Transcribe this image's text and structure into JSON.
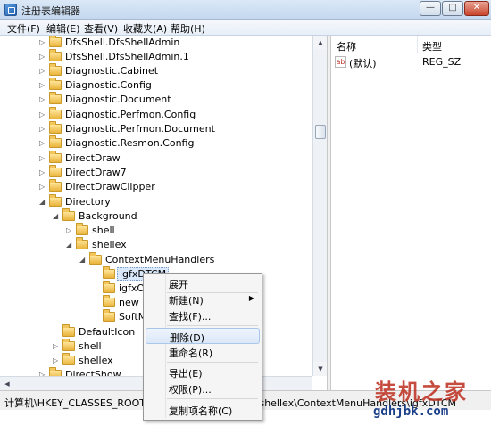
{
  "window": {
    "title": "注册表编辑器",
    "min_glyph": "—",
    "max_glyph": "□",
    "close_glyph": "✕"
  },
  "menu": [
    "文件(F)",
    "编辑(E)",
    "查看(V)",
    "收藏夹(A)",
    "帮助(H)"
  ],
  "tree": [
    {
      "label": "DfsShell.DfsShellAdmin",
      "expander": "▷"
    },
    {
      "label": "DfsShell.DfsShellAdmin.1",
      "expander": "▷"
    },
    {
      "label": "Diagnostic.Cabinet",
      "expander": "▷"
    },
    {
      "label": "Diagnostic.Config",
      "expander": "▷"
    },
    {
      "label": "Diagnostic.Document",
      "expander": "▷"
    },
    {
      "label": "Diagnostic.Perfmon.Config",
      "expander": "▷"
    },
    {
      "label": "Diagnostic.Perfmon.Document",
      "expander": "▷"
    },
    {
      "label": "Diagnostic.Resmon.Config",
      "expander": "▷"
    },
    {
      "label": "DirectDraw",
      "expander": "▷"
    },
    {
      "label": "DirectDraw7",
      "expander": "▷"
    },
    {
      "label": "DirectDrawClipper",
      "expander": "▷"
    },
    {
      "label": "Directory",
      "expander": "◢"
    },
    {
      "label": "Background",
      "expander": "◢"
    },
    {
      "label": "shell",
      "expander": "▷"
    },
    {
      "label": "shellex",
      "expander": "◢"
    },
    {
      "label": "ContextMenuHandlers",
      "expander": "◢"
    },
    {
      "label": "igfxDTCM",
      "expander": ""
    },
    {
      "label": "igfxOSP",
      "expander": ""
    },
    {
      "label": "new",
      "expander": ""
    },
    {
      "label": "SoftMgr",
      "expander": ""
    },
    {
      "label": "DefaultIcon",
      "expander": ""
    },
    {
      "label": "shell",
      "expander": "▷"
    },
    {
      "label": "shellex",
      "expander": "▷"
    },
    {
      "label": "DirectShow",
      "expander": "▷"
    }
  ],
  "list": {
    "col_name": "名称",
    "col_type": "类型",
    "rows": [
      {
        "icon": "ab",
        "name": "(默认)",
        "type": "REG_SZ"
      }
    ]
  },
  "status": {
    "path": "计算机\\HKEY_CLASSES_ROOT\\Directory\\Background\\shellex\\ContextMenuHandlers\\igfxDTCM"
  },
  "context_menu": {
    "items": [
      {
        "label": "展开"
      },
      {
        "label": "新建(N)",
        "submenu": "▶"
      },
      {
        "label": "查找(F)..."
      },
      {
        "label": "删除(D)"
      },
      {
        "label": "重命名(R)"
      },
      {
        "label": "导出(E)"
      },
      {
        "label": "权限(P)..."
      },
      {
        "label": "复制项名称(C)"
      }
    ]
  },
  "watermark": {
    "logo": "装机之家",
    "url": "gdhjbk.com"
  },
  "scroll": {
    "up": "▲",
    "down": "▼",
    "left": "◀"
  }
}
